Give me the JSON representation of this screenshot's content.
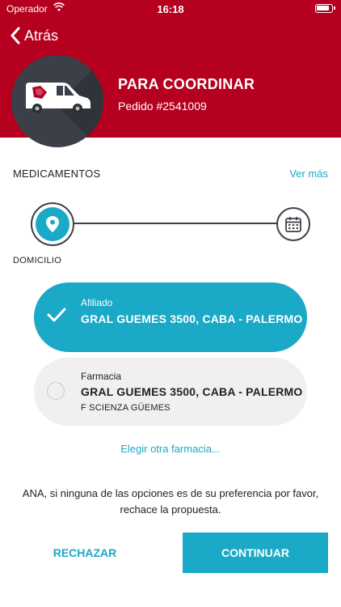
{
  "status_bar": {
    "carrier": "Operador",
    "time": "16:18"
  },
  "nav": {
    "back_label": "Atrás"
  },
  "order": {
    "status": "PARA COORDINAR",
    "number": "Pedido #2541009"
  },
  "section": {
    "title": "MEDICAMENTOS",
    "see_more": "Ver más"
  },
  "stepper": {
    "current_step_label": "DOMICILIO"
  },
  "options": [
    {
      "type": "Afiliado",
      "address": "GRAL GUEMES 3500, CABA - PALERMO",
      "pharmacy": "",
      "selected": true
    },
    {
      "type": "Farmacia",
      "address": "GRAL GUEMES 3500, CABA - PALERMO",
      "pharmacy": "F SCIENZA GÜEMES",
      "selected": false
    }
  ],
  "other_pharmacy_link": "Elegir otra farmacia...",
  "hint_lines": [
    "ANA, si ninguna de las opciones es de su preferencia por favor,",
    "rechace la propuesta."
  ],
  "actions": {
    "reject_label": "RECHAZAR",
    "continue_label": "CONTINUAR"
  },
  "colors": {
    "brand_red": "#b5001f",
    "accent_teal": "#1aa9c7",
    "dark_gray": "#3b4048"
  },
  "icons": {
    "hero": "delivery-van-icon",
    "step1": "location-pin-icon",
    "step2": "calendar-icon"
  }
}
